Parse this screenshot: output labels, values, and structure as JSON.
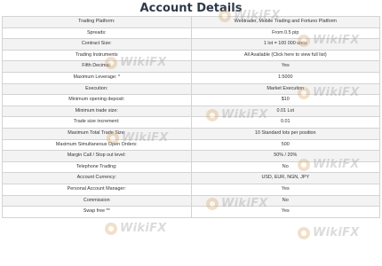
{
  "title": "Account Details",
  "rows": [
    {
      "label": "Trading Platform:",
      "value": "Webtrader, Mobile Trading and Fortuno Platform"
    },
    {
      "label": "Spreads:",
      "value": "From 0.5 pip"
    },
    {
      "label": "Contract Size:",
      "value": "1 lot = 100 000 units"
    },
    {
      "label": "Trading Instruments",
      "value": "All Available (Click here to view full list)"
    },
    {
      "label": "Fifth Decimal:",
      "value": "Yes"
    },
    {
      "label": "Maximum Leverage: *",
      "value": "1:5000"
    },
    {
      "label": "Execution:",
      "value": "Market Execution"
    },
    {
      "label": "Minimum opening deposit:",
      "value": "$10"
    },
    {
      "label": "Minimum trade size:",
      "value": "0.01 Lot"
    },
    {
      "label": "Trade size increment:",
      "value": "0.01"
    },
    {
      "label": "Maximum Total Trade Size:",
      "value": "10 Standard lots per position"
    },
    {
      "label": "Maximum Simultaneous Open Orders:",
      "value": "500"
    },
    {
      "label": "Margin Call / Stop out level:",
      "value": "50% / 20%"
    },
    {
      "label": "Telephone Trading:",
      "value": "No"
    },
    {
      "label": "Account Currency:",
      "value": "USD, EUR, NGN, JPY"
    },
    {
      "label": "Personal Account Manager:",
      "value": "Yes"
    },
    {
      "label": "Commission",
      "value": "No"
    },
    {
      "label": "Swap free **",
      "value": "Yes"
    }
  ],
  "watermark": {
    "text": "WikiFX",
    "icon": "wikifx-logo-icon"
  }
}
